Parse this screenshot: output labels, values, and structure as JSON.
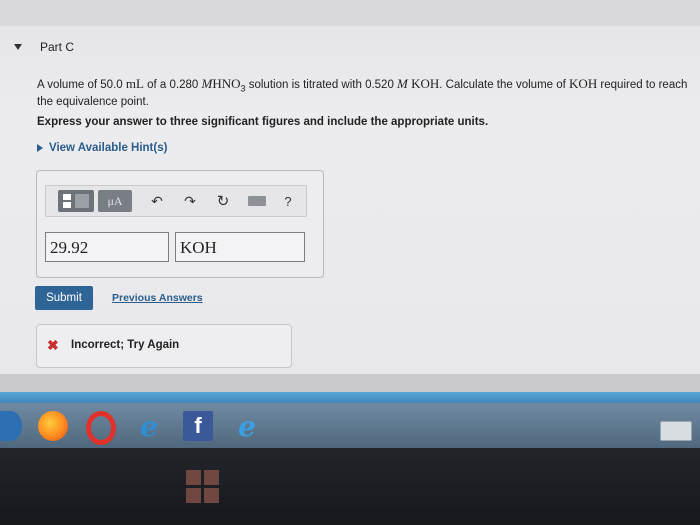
{
  "part": {
    "title": "Part C"
  },
  "question": {
    "t1": "A volume of 50.0",
    "u1": "mL",
    "t2": "of a 0.280",
    "c1": "M",
    "c2": "HNO",
    "sub": "3",
    "t3": "solution is titrated with 0.520",
    "c3": "M",
    "c4": "KOH",
    "t4": ". Calculate the volume of",
    "c5": "KOH",
    "t5": "required to reach the equivalence point."
  },
  "instruction": "Express your answer to three significant figures and include the appropriate units.",
  "hint": {
    "label": "View Available Hint(s)"
  },
  "toolbar": {
    "mu_label": "μA",
    "undo": "↶",
    "redo": "↷",
    "reset": "↻",
    "help": "?"
  },
  "answer": {
    "value": "29.92",
    "unit": "KOH"
  },
  "actions": {
    "submit_label": "Submit",
    "previous_label": "Previous Answers"
  },
  "feedback": {
    "icon": "✖",
    "text": "Incorrect; Try Again"
  },
  "taskbar": {
    "icons": [
      "media-player-icon",
      "firefox-icon",
      "opera-icon",
      "internet-explorer-icon",
      "facebook-icon",
      "internet-explorer-icon",
      "touch-keyboard-icon"
    ],
    "fb_glyph": "f",
    "ie_glyph": "e"
  },
  "colors": {
    "accent": "#2f6596",
    "link": "#2a5d8a",
    "error": "#c9302c"
  }
}
